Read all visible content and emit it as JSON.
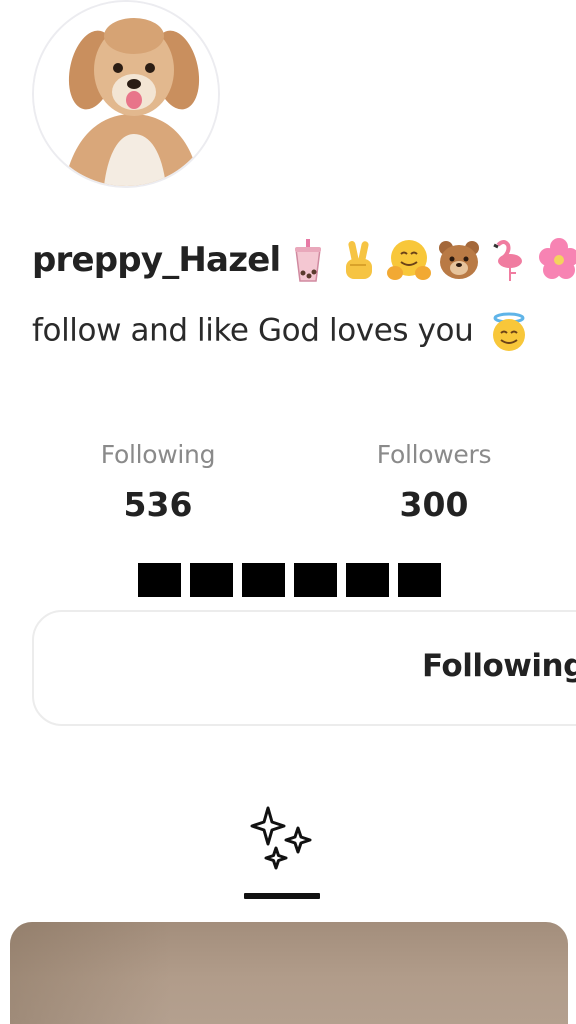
{
  "profile": {
    "username": "preppy_Hazel",
    "username_emojis": [
      "bubble-tea-emoji",
      "victory-hand-emoji",
      "hugging-face-emoji",
      "bear-face-emoji",
      "flamingo-emoji",
      "hibiscus-emoji"
    ],
    "bio": "follow and like God loves you",
    "bio_emoji": "smiling-face-with-halo-emoji",
    "avatar": "puppy-avatar"
  },
  "stats": {
    "following_label": "Following",
    "following_count": "536",
    "followers_label": "Followers",
    "followers_count": "300"
  },
  "action_button": {
    "label": "Following"
  },
  "tabs": {
    "active_icon": "sparkles-icon"
  },
  "colors": {
    "text_primary": "#222222",
    "text_secondary": "#8a8a8a",
    "button_border": "#ececec",
    "redaction": "#000000"
  }
}
